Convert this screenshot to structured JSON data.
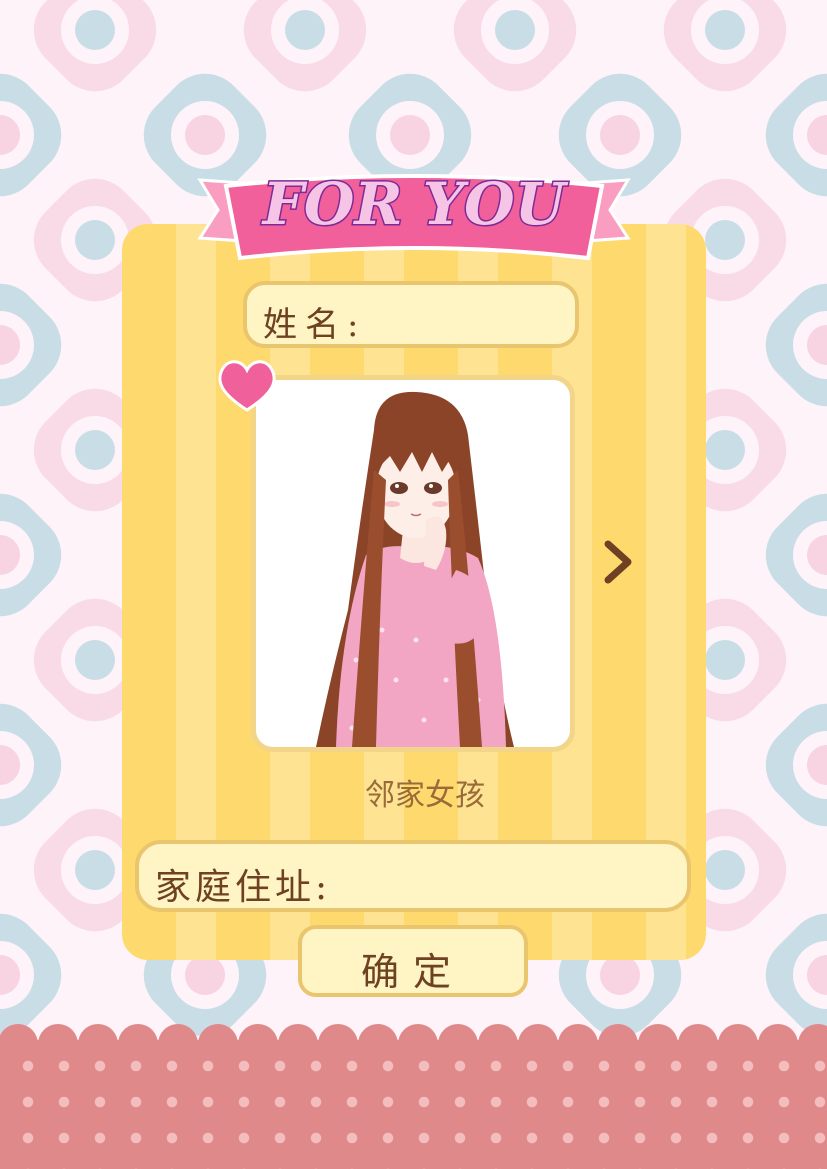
{
  "banner": {
    "title": "FOR YOU"
  },
  "form": {
    "name_label": "姓名:",
    "character_name": "邻家女孩",
    "address_label": "家庭住址:",
    "confirm_label": "确定"
  },
  "icons": {
    "heart": "heart-icon",
    "next": "chevron-right-icon"
  },
  "colors": {
    "card_stripe_dark": "#fed96e",
    "card_stripe_light": "#fde392",
    "field_bg": "#fff4c4",
    "field_border": "#e9c66e",
    "label_text": "#6e4122",
    "ribbon": "#f2609b",
    "ribbon_text": "#8a3fa8",
    "heart": "#f0609a",
    "bottom_band": "#e0898a"
  }
}
